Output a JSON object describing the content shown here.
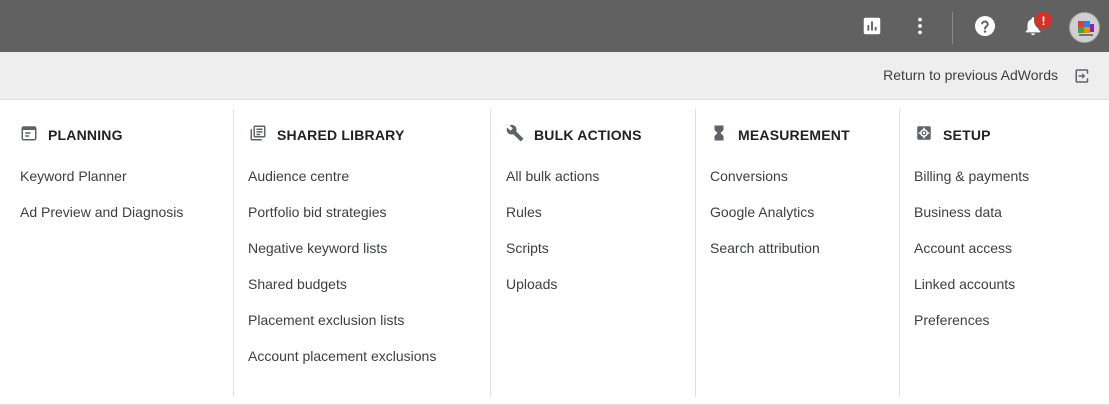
{
  "topbar": {
    "icons": [
      "reports-icon",
      "more-vert-icon",
      "help-icon",
      "notifications-icon"
    ],
    "notification_badge": "!",
    "bg_color": "#616161"
  },
  "subbar": {
    "return_label": "Return to previous AdWords"
  },
  "columns": [
    {
      "title": "PLANNING",
      "icon": "calendar-icon",
      "items": [
        "Keyword Planner",
        "Ad Preview and Diagnosis"
      ]
    },
    {
      "title": "SHARED LIBRARY",
      "icon": "library-icon",
      "items": [
        "Audience centre",
        "Portfolio bid strategies",
        "Negative keyword lists",
        "Shared budgets",
        "Placement exclusion lists",
        "Account placement exclusions"
      ]
    },
    {
      "title": "BULK ACTIONS",
      "icon": "wrench-icon",
      "items": [
        "All bulk actions",
        "Rules",
        "Scripts",
        "Uploads"
      ]
    },
    {
      "title": "MEASUREMENT",
      "icon": "hourglass-icon",
      "items": [
        "Conversions",
        "Google Analytics",
        "Search attribution"
      ]
    },
    {
      "title": "SETUP",
      "icon": "settings-icon",
      "items": [
        "Billing & payments",
        "Business data",
        "Account access",
        "Linked accounts",
        "Preferences"
      ]
    }
  ]
}
